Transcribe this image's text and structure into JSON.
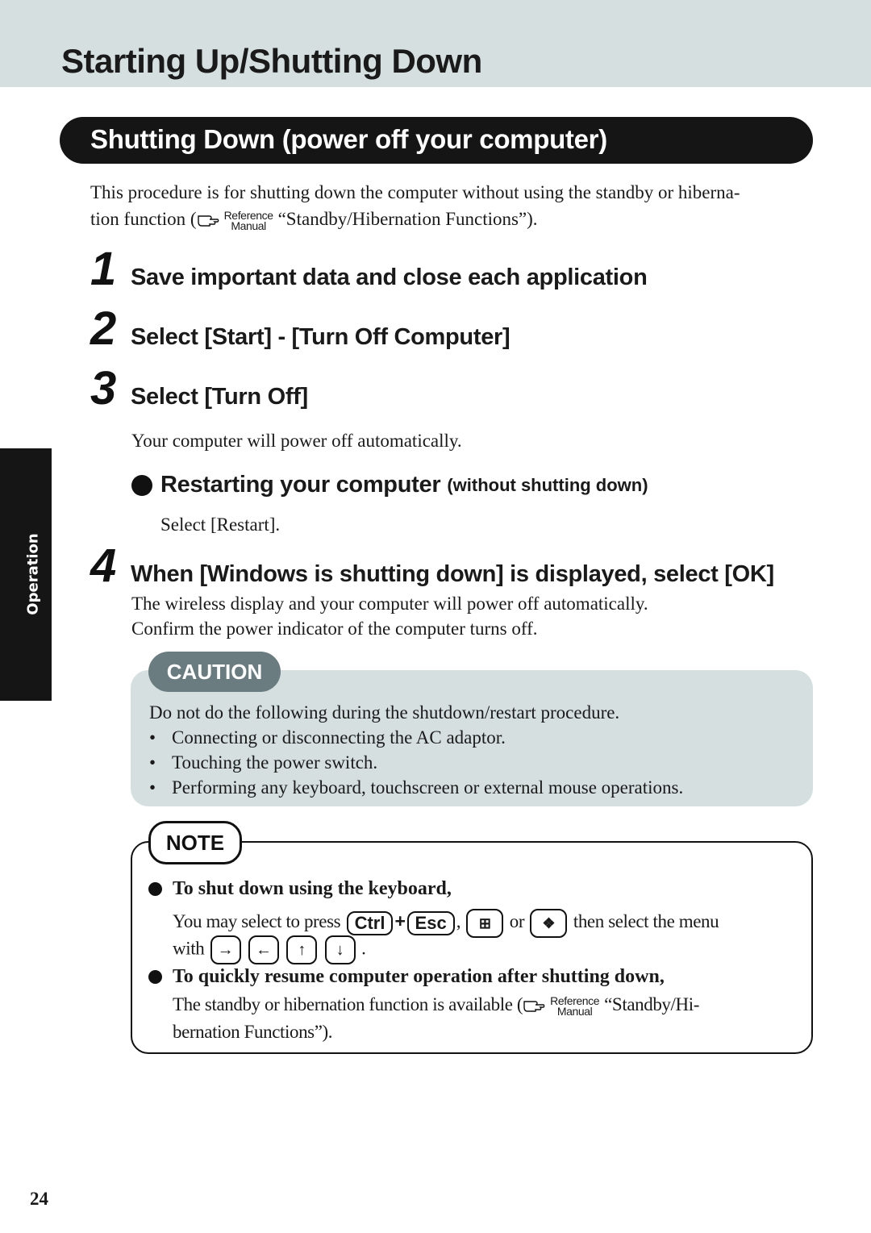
{
  "page": {
    "title": "Starting Up/Shutting Down",
    "section_title": "Shutting Down (power off your computer)",
    "side_tab": "Operation",
    "page_number": "24",
    "colors": {
      "header_band": "#d5dfe0",
      "pill": "#151515",
      "caution_tag": "#6b7c80",
      "caution_box": "#d5dfe0"
    }
  },
  "intro": {
    "line1": "This procedure is for shutting down the computer without using the standby or hiberna-",
    "line2_before": "tion function (",
    "ref_top": "Reference",
    "ref_bottom": "Manual",
    "line2_after": "“Standby/Hibernation Functions”)."
  },
  "steps": [
    {
      "num": "1",
      "text": "Save important data and close each application"
    },
    {
      "num": "2",
      "text": "Select [Start] - [Turn Off Computer]"
    },
    {
      "num": "3",
      "text": "Select [Turn Off]",
      "body": "Your computer will power off automatically."
    },
    {
      "num": "4",
      "text": "When [Windows is shutting down] is displayed, select [OK]",
      "body1": "The wireless display and your computer will power off automatically.",
      "body2": "Confirm the power indicator of the computer turns off."
    }
  ],
  "restart": {
    "heading": "Restarting your computer",
    "subheading": "(without shutting down)",
    "body": "Select [Restart]."
  },
  "caution": {
    "label": "CAUTION",
    "intro": "Do not do the following during the shutdown/restart procedure.",
    "bullet_char": "•",
    "items": [
      "Connecting or disconnecting the AC adaptor.",
      "Touching the power switch.",
      "Performing any keyboard, touchscreen or external mouse operations."
    ]
  },
  "note": {
    "label": "NOTE",
    "item1": {
      "heading": "To shut down using the keyboard,",
      "text_before": "You may select to press",
      "key_ctrl": "Ctrl",
      "plus": "+",
      "key_esc": "Esc",
      "comma": ",",
      "or": "or",
      "text_after": "then select the menu",
      "with": "with",
      "period": ".",
      "keys_icons": [
        "windows-logo-key-icon",
        "windows-flag-key-icon"
      ],
      "arrows": [
        "→",
        "←",
        "↑",
        "↓"
      ]
    },
    "item2": {
      "heading": "To quickly resume computer operation after shutting down,",
      "line1_before": "The standby or hibernation function is available (",
      "ref_top": "Reference",
      "ref_bottom": "Manual",
      "line1_after": "“Standby/Hi-",
      "line2": "bernation Functions”)."
    }
  }
}
